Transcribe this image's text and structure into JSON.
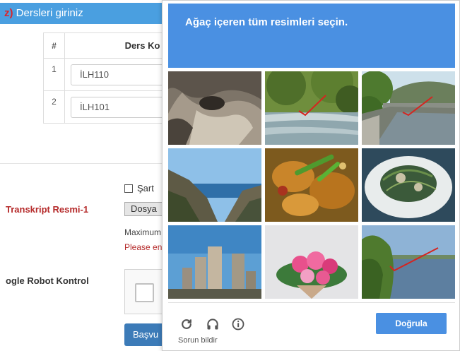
{
  "background_form": {
    "section_header": {
      "required_mark": "z)",
      "title": "Dersleri giriniz"
    },
    "course_table": {
      "headers": {
        "index": "#",
        "code": "Ders Ko"
      },
      "rows": [
        {
          "index": "1",
          "code": "İLH110"
        },
        {
          "index": "2",
          "code": "İLH101"
        }
      ]
    },
    "condition_label": "Şart",
    "transcript_label": "Transkript Resmi-1",
    "file_button_label": "Dosya",
    "max_text": "Maximum",
    "please_text": "Please en",
    "robot_label": "ogle Robot Kontrol",
    "apply_button_label": "Başvu"
  },
  "captcha": {
    "instruction_keyword": "Ağaç",
    "instruction_rest": " içeren tüm resimleri seçin.",
    "header_color": "#4a90e2",
    "tiles": [
      {
        "subject": "rock cave",
        "marked": false
      },
      {
        "subject": "river with trees",
        "marked": true
      },
      {
        "subject": "canal with bridge and trees",
        "marked": true
      },
      {
        "subject": "mountain coast",
        "marked": false
      },
      {
        "subject": "food plate",
        "marked": false
      },
      {
        "subject": "salad plate",
        "marked": false
      },
      {
        "subject": "city skyscrapers",
        "marked": false
      },
      {
        "subject": "flower bouquet",
        "marked": false
      },
      {
        "subject": "lake with trees",
        "marked": true
      }
    ],
    "footer": {
      "reload_icon": "reload-icon",
      "audio_icon": "headphones-icon",
      "info_icon": "info-icon",
      "report_label": "Sorun bildir",
      "verify_label": "Doğrula"
    }
  }
}
